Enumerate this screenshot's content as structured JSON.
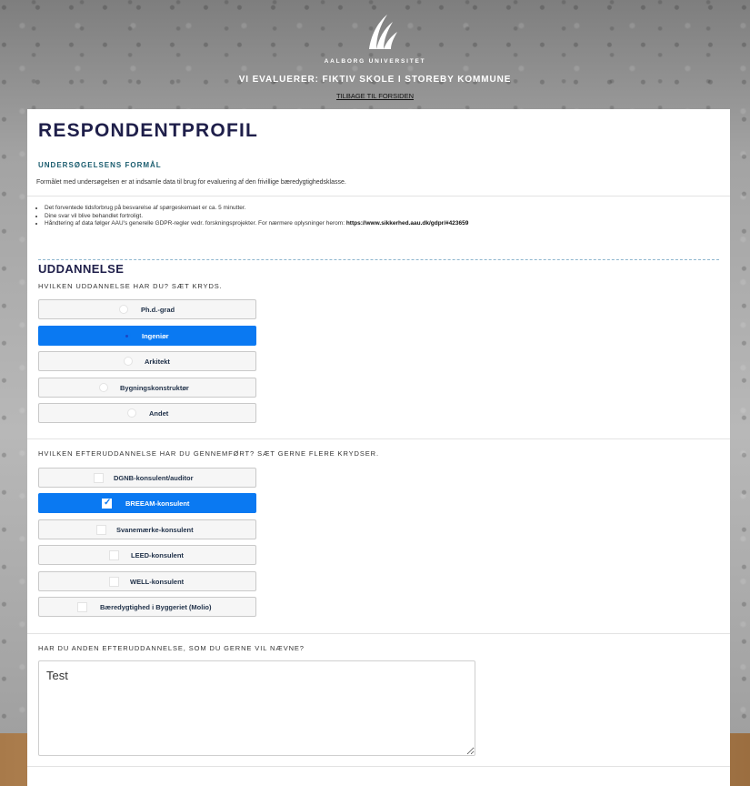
{
  "header": {
    "university": "AALBORG UNIVERSITET",
    "project_title": "VI EVALUERER: FIKTIV SKOLE I STOREBY KOMMUNE",
    "back_link": "TILBAGE TIL FORSIDEN"
  },
  "page_title": "RESPONDENTPROFIL",
  "purpose": {
    "heading": "UNDERSØGELSENS FORMÅL",
    "text": "Formålet med undersøgelsen er at indsamle data til brug for evaluering af den frivillige bæredygtighedsklasse.",
    "bullets": [
      "Det forventede tidsforbrug på besvarelse af spørgeskemaet er ca. 5 minutter.",
      "Dine svar vil blive behandlet fortroligt."
    ],
    "gdpr_text": "Håndtering af data følger AAU's generelle GDPR-regler vedr. forskningsprojekter. For nærmere oplysninger herom: ",
    "gdpr_link": "https://www.sikkerhed.aau.dk/gdpr/#423659"
  },
  "section": "UDDANNELSE",
  "q1": {
    "label": "HVILKEN UDDANNELSE HAR DU? SÆT KRYDS.",
    "options": [
      "Ph.d.-grad",
      "Ingeniør",
      "Arkitekt",
      "Bygningskonstruktør",
      "Andet"
    ],
    "selected": "Ingeniør"
  },
  "q2": {
    "label": "HVILKEN EFTERUDDANNELSE HAR DU GENNEMFØRT? SÆT GERNE FLERE KRYDSER.",
    "options": [
      "DGNB-konsulent/auditor",
      "BREEAM-konsulent",
      "Svanemærke-konsulent",
      "LEED-konsulent",
      "WELL-konsulent",
      "Bæredygtighed i Byggeriet (Molio)"
    ],
    "checked": [
      "BREEAM-konsulent"
    ]
  },
  "q3": {
    "label": "HAR DU ANDEN EFTERUDDANNELSE, SOM DU GERNE VIL NÆVNE?",
    "value": "Test"
  },
  "colors": {
    "accent": "#0a79f2",
    "title": "#1f1f4a",
    "section_label": "#1a5c6e"
  }
}
